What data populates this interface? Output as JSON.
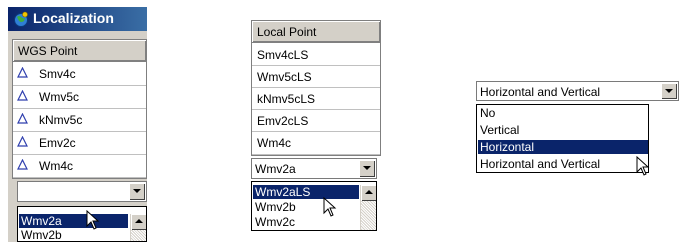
{
  "left_panel": {
    "title": "Localization",
    "column_header": "WGS Point",
    "rows": [
      "Smv4c",
      "Wmv5c",
      "kNmv5c",
      "Emv2c",
      "Wm4c"
    ],
    "combo_value": "",
    "dropdown_options": [
      "Wmv2a",
      "Wmv2b"
    ],
    "selected_option": "Wmv2a"
  },
  "middle_panel": {
    "column_header": "Local Point",
    "rows": [
      "Smv4cLS",
      "Wmv5cLS",
      "kNmv5cLS",
      "Emv2cLS",
      "Wm4c"
    ],
    "combo_value": "Wmv2a",
    "dropdown_options": [
      "Wmv2aLS",
      "Wmv2b",
      "Wmv2c"
    ],
    "selected_option": "Wmv2aLS"
  },
  "right_combo": {
    "value": "Horizontal and Vertical",
    "options": [
      "No",
      "Vertical",
      "Horizontal",
      "Horizontal and Vertical"
    ],
    "selected_option": "Horizontal"
  },
  "colors": {
    "title_bar": "#0a246a",
    "selection": "#0a246a",
    "face": "#d4d0c8",
    "triangle_icon": "#2f3fae"
  },
  "icons": {
    "window_icon": "globe-icon",
    "row_icon": "triangle-point-icon",
    "cursor": "mouse-cursor-icon"
  }
}
